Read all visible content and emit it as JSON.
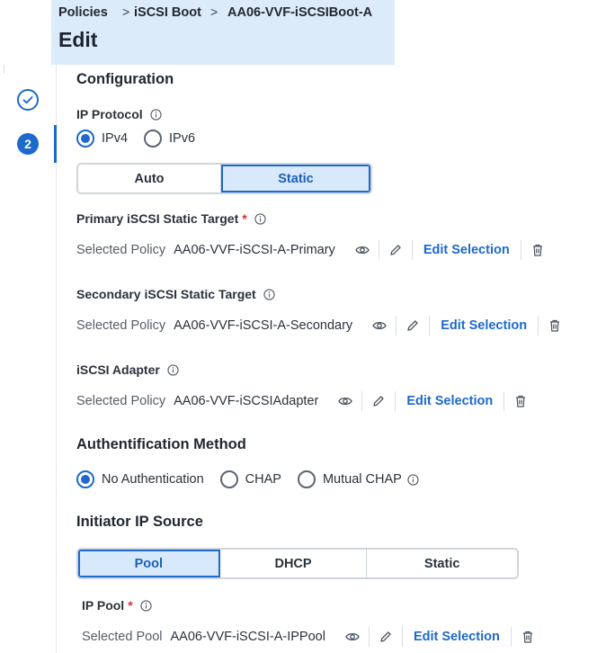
{
  "breadcrumb": {
    "items": [
      "Policies",
      "iSCSI Boot",
      "AA06-VVF-iSCSIBoot-A"
    ],
    "separator": ">"
  },
  "page_title": "Edit",
  "steps": {
    "current_number": "2"
  },
  "configuration": {
    "title": "Configuration",
    "ip_protocol": {
      "label": "IP Protocol",
      "options": [
        "IPv4",
        "IPv6"
      ],
      "selected": "IPv4"
    },
    "address_mode": {
      "options": [
        "Auto",
        "Static"
      ],
      "selected": "Static"
    },
    "primary_target": {
      "label": "Primary iSCSI Static Target",
      "required_mark": "*",
      "selected_label": "Selected Policy",
      "value": "AA06-VVF-iSCSI-A-Primary",
      "edit_label": "Edit Selection"
    },
    "secondary_target": {
      "label": "Secondary iSCSI Static Target",
      "selected_label": "Selected Policy",
      "value": "AA06-VVF-iSCSI-A-Secondary",
      "edit_label": "Edit Selection"
    },
    "adapter": {
      "label": "iSCSI Adapter",
      "selected_label": "Selected Policy",
      "value": "AA06-VVF-iSCSIAdapter",
      "edit_label": "Edit Selection"
    }
  },
  "authentication": {
    "title": "Authentification Method",
    "options": [
      "No Authentication",
      "CHAP",
      "Mutual CHAP"
    ],
    "selected": "No Authentication"
  },
  "initiator": {
    "title": "Initiator IP Source",
    "options": [
      "Pool",
      "DHCP",
      "Static"
    ],
    "selected": "Pool",
    "ip_pool": {
      "label": "IP Pool",
      "required_mark": "*",
      "selected_label": "Selected Pool",
      "value": "AA06-VVF-iSCSI-A-IPPool",
      "edit_label": "Edit Selection"
    }
  },
  "colors": {
    "accent": "#1d69cc",
    "header_bg": "#dcebfa",
    "required": "#d62f2f"
  },
  "icons": [
    "check-icon",
    "info-icon",
    "eye-icon",
    "pencil-icon",
    "trash-icon"
  ]
}
